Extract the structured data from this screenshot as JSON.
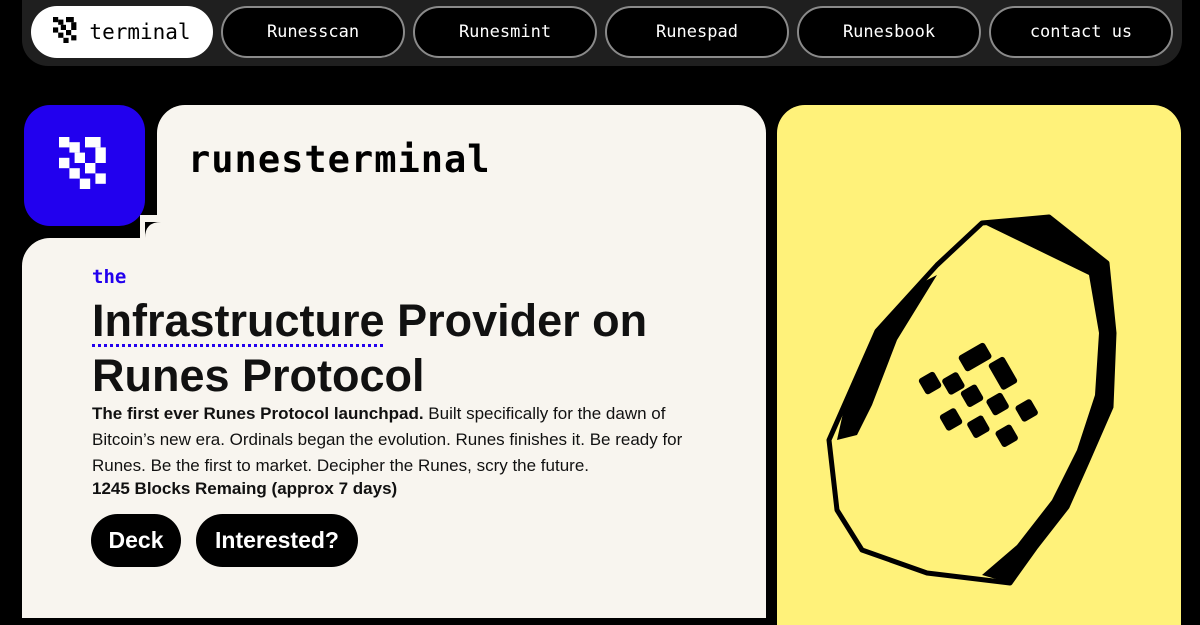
{
  "nav": {
    "home_label": "terminal",
    "items": [
      {
        "label": "Runesscan"
      },
      {
        "label": "Runesmint"
      },
      {
        "label": "Runespad"
      },
      {
        "label": "Runesbook"
      },
      {
        "label": "contact us"
      }
    ]
  },
  "hero": {
    "brand": "runesterminal",
    "eyebrow": "the",
    "headline_underlined": "Infrastructure",
    "headline_rest_line1": " Provider on",
    "headline_line2": "Runes Protocol",
    "body_bold": "The first ever Runes Protocol launchpad.",
    "body_text": " Built specifically for the dawn of Bitcoin’s new era. Ordinals began the evolution. Runes finishes it. Be ready for Runes. Be the first to market. Decipher the Runes, scry the future.",
    "blocks_remaining": "1245 Blocks Remaing (approx 7 days)",
    "buttons": {
      "deck": "Deck",
      "interested": "Interested?"
    }
  },
  "icons": {
    "logo": "rune-glyph-icon",
    "stone": "rune-stone-illustration"
  },
  "colors": {
    "background": "#000000",
    "card": "#f8f5ef",
    "accent_blue": "#2200ee",
    "accent_yellow": "#fff27a",
    "nav_bar": "#1f1f1f"
  }
}
